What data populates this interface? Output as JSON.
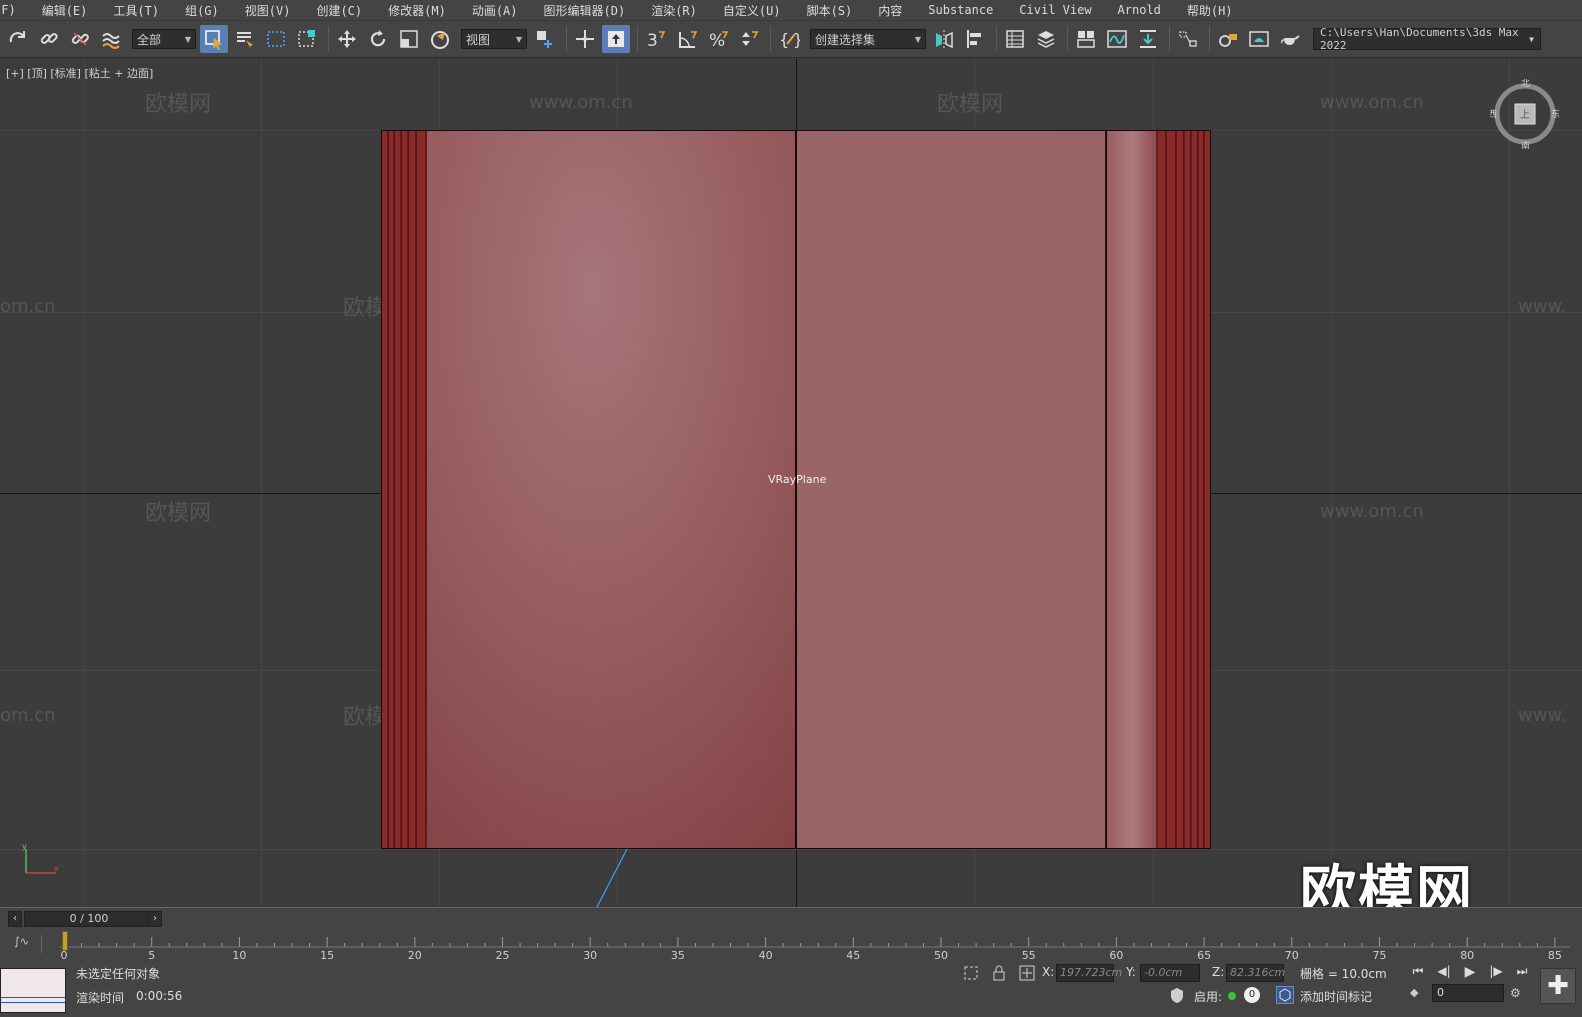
{
  "menu": {
    "items": [
      "(F)",
      "编辑(E)",
      "工具(T)",
      "组(G)",
      "视图(V)",
      "创建(C)",
      "修改器(M)",
      "动画(A)",
      "图形编辑器(D)",
      "渲染(R)",
      "自定义(U)",
      "脚本(S)",
      "内容",
      "Substance",
      "Civil View",
      "Arnold",
      "帮助(H)"
    ]
  },
  "toolbar": {
    "selection_filter": "全部",
    "reference_coord": "视图",
    "named_selection": "创建选择集",
    "project_path": "C:\\Users\\Han\\Documents\\3ds Max 2022"
  },
  "viewport": {
    "label": "[+] [顶] [标准] [粘土 + 边面]",
    "object_name": "VRayPlane",
    "watermark_cn": "欧模网",
    "watermark_url": "www.om.cn",
    "watermark_url_partial": "om.cn",
    "watermark_url_partial_right": "www.",
    "logo": "欧模网",
    "viewcube": {
      "north": "北",
      "south": "南",
      "west": "西",
      "east": "东",
      "face": "上"
    },
    "colors": {
      "panel_light": "#9e6568",
      "panel_mid": "#8e4c50",
      "trim": "#8a2a2a",
      "edge": "#1b0808"
    }
  },
  "timeline": {
    "frame_display": "0 / 100",
    "ticks": [
      "0",
      "5",
      "10",
      "15",
      "20",
      "25",
      "30",
      "35",
      "40",
      "45",
      "50",
      "55",
      "60",
      "65",
      "70",
      "75",
      "80",
      "85"
    ]
  },
  "status": {
    "selection": "未选定任何对象",
    "render_time_label": "渲染时间",
    "render_time": "0:00:56",
    "x_label": "X:",
    "x_value": "197.723cm",
    "y_label": "Y:",
    "y_value": "-0.0cm",
    "z_label": "Z:",
    "z_value": "82.316cm",
    "grid": "栅格 = 10.0cm",
    "enable_label": "启用:",
    "enable_count": "0",
    "add_time_tag": "添加时间标记",
    "current_frame": "0"
  }
}
